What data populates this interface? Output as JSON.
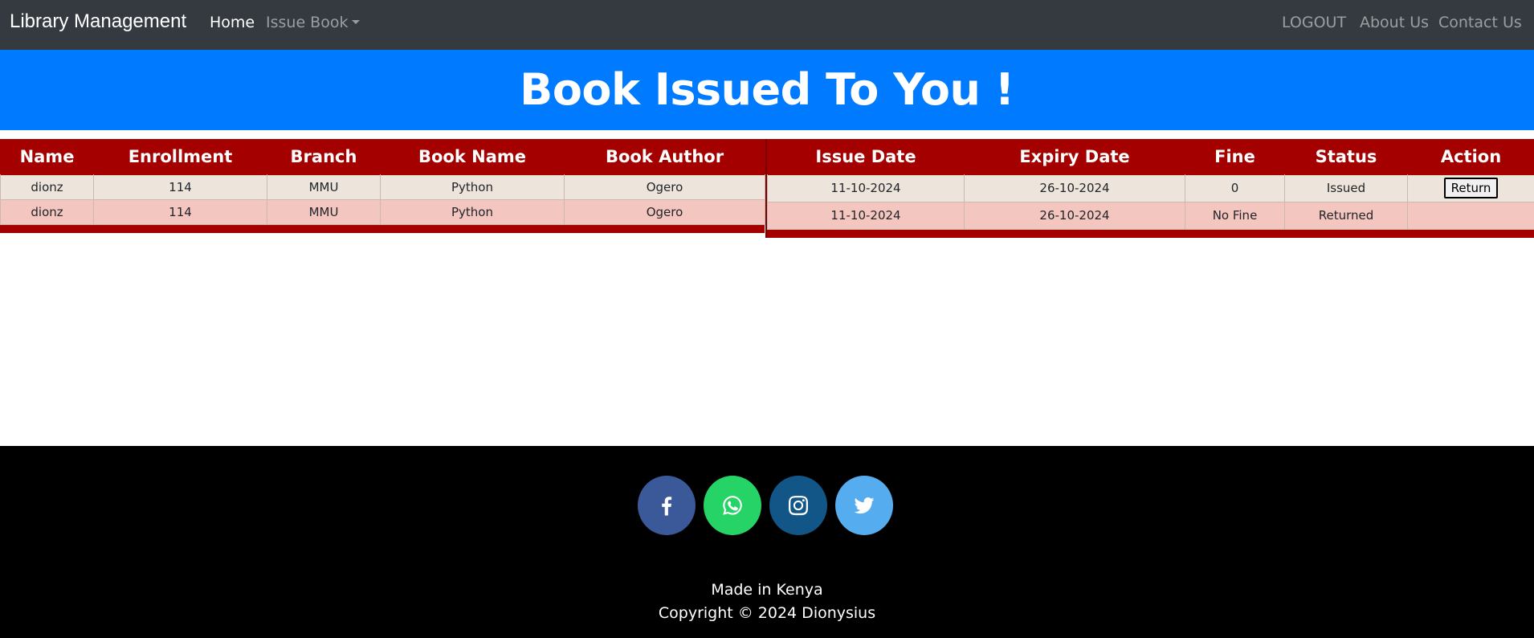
{
  "navbar": {
    "brand": "Library Management",
    "home": "Home",
    "issue_book": "Issue Book",
    "logout": "LOGOUT",
    "about": "About Us",
    "contact": "Contact Us"
  },
  "banner": {
    "title": "Book Issued To You !"
  },
  "left_table": {
    "headers": [
      "Name",
      "Enrollment",
      "Branch",
      "Book Name",
      "Book Author"
    ],
    "rows": [
      [
        "dionz",
        "114",
        "MMU",
        "Python",
        "Ogero"
      ],
      [
        "dionz",
        "114",
        "MMU",
        "Python",
        "Ogero"
      ]
    ]
  },
  "right_table": {
    "headers": [
      "Issue Date",
      "Expiry Date",
      "Fine",
      "Status",
      "Action"
    ],
    "rows": [
      [
        "11-10-2024",
        "26-10-2024",
        "0",
        "Issued",
        "Return"
      ],
      [
        "11-10-2024",
        "26-10-2024",
        "No Fine",
        "Returned",
        ""
      ]
    ]
  },
  "footer": {
    "social": [
      {
        "icon": "facebook-icon",
        "color": "#3b5998"
      },
      {
        "icon": "whatsapp-icon",
        "color": "#25d366"
      },
      {
        "icon": "instagram-icon",
        "color": "#125688"
      },
      {
        "icon": "twitter-icon",
        "color": "#55acee"
      }
    ],
    "made_in": "Made in Kenya",
    "copyright": "Copyright © 2024 Dionysius"
  }
}
